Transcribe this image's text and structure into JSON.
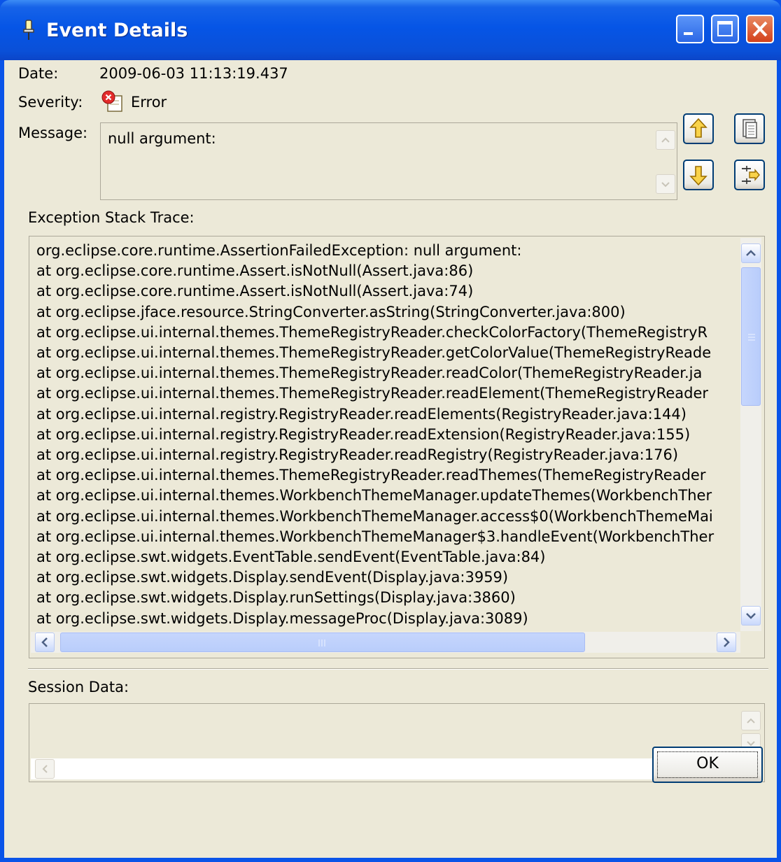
{
  "window": {
    "title": "Event Details"
  },
  "fields": {
    "date_label": "Date:",
    "date_value": "2009-06-03 11:13:19.437",
    "severity_label": "Severity:",
    "severity_value": "Error",
    "message_label": "Message:",
    "message_value": "null argument:"
  },
  "sections": {
    "stack_trace_label": "Exception Stack Trace:",
    "session_data_label": "Session Data:"
  },
  "stack_trace": [
    "org.eclipse.core.runtime.AssertionFailedException: null argument:",
    "at org.eclipse.core.runtime.Assert.isNotNull(Assert.java:86)",
    "at org.eclipse.core.runtime.Assert.isNotNull(Assert.java:74)",
    "at org.eclipse.jface.resource.StringConverter.asString(StringConverter.java:800)",
    "at org.eclipse.ui.internal.themes.ThemeRegistryReader.checkColorFactory(ThemeRegistryR",
    "at org.eclipse.ui.internal.themes.ThemeRegistryReader.getColorValue(ThemeRegistryReade",
    "at org.eclipse.ui.internal.themes.ThemeRegistryReader.readColor(ThemeRegistryReader.ja",
    "at org.eclipse.ui.internal.themes.ThemeRegistryReader.readElement(ThemeRegistryReader",
    "at org.eclipse.ui.internal.registry.RegistryReader.readElements(RegistryReader.java:144)",
    "at org.eclipse.ui.internal.registry.RegistryReader.readExtension(RegistryReader.java:155)",
    "at org.eclipse.ui.internal.registry.RegistryReader.readRegistry(RegistryReader.java:176)",
    "at org.eclipse.ui.internal.themes.ThemeRegistryReader.readThemes(ThemeRegistryReader",
    "at org.eclipse.ui.internal.themes.WorkbenchThemeManager.updateThemes(WorkbenchTher",
    "at org.eclipse.ui.internal.themes.WorkbenchThemeManager.access$0(WorkbenchThemeMai",
    "at org.eclipse.ui.internal.themes.WorkbenchThemeManager$3.handleEvent(WorkbenchTher",
    "at org.eclipse.swt.widgets.EventTable.sendEvent(EventTable.java:84)",
    "at org.eclipse.swt.widgets.Display.sendEvent(Display.java:3959)",
    "at org.eclipse.swt.widgets.Display.runSettings(Display.java:3860)",
    "at org.eclipse.swt.widgets.Display.messageProc(Display.java:3089)"
  ],
  "buttons": {
    "ok_label": "OK"
  },
  "icons": {
    "title": "pin-icon",
    "severity": "error-icon",
    "previous": "arrow-up-icon",
    "next": "arrow-down-icon",
    "copy": "copy-icon",
    "sort": "sort-icon"
  }
}
